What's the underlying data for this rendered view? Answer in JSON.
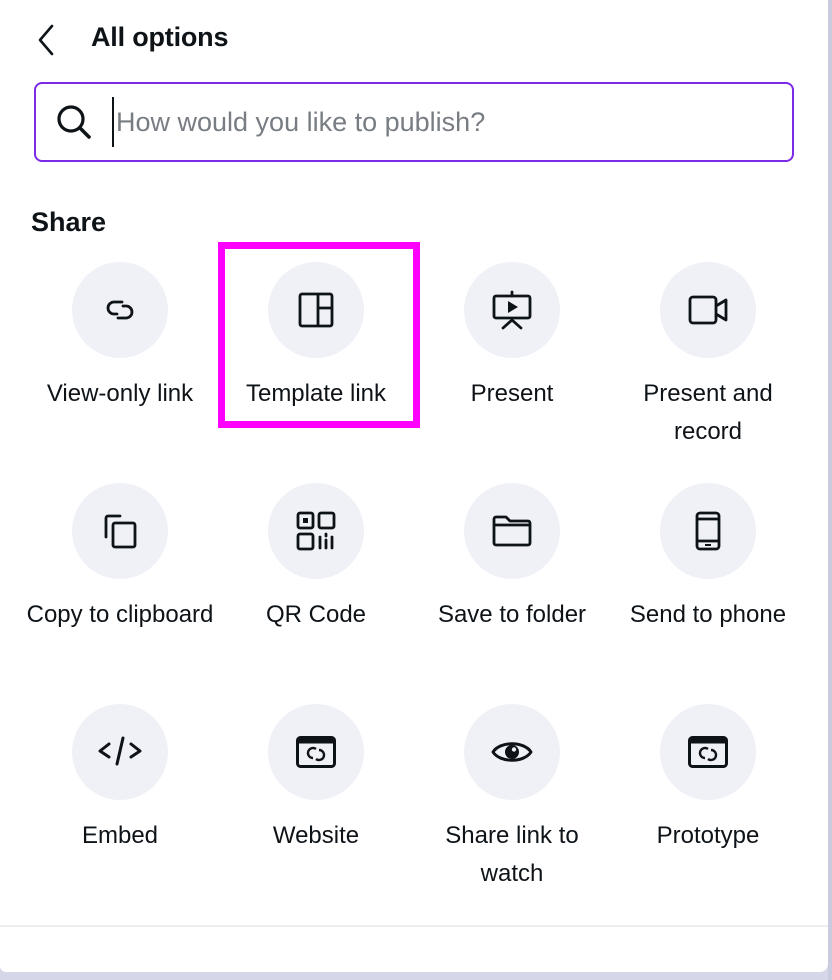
{
  "header": {
    "back_icon": "chevron-left-icon",
    "title": "All options"
  },
  "search": {
    "icon": "search-icon",
    "value": "",
    "placeholder": "How would you like to publish?"
  },
  "colors": {
    "accent": "#7d2ae8",
    "highlight": "#ff00ff",
    "tile_bg": "#eff1f7",
    "text": "#0e1318",
    "placeholder": "#787d83"
  },
  "share": {
    "title": "Share",
    "items": [
      {
        "label": "View-only link",
        "icon": "link-icon"
      },
      {
        "label": "Template link",
        "icon": "template-layout-icon",
        "highlighted": true
      },
      {
        "label": "Present",
        "icon": "presentation-icon"
      },
      {
        "label": "Present and record",
        "icon": "video-camera-icon"
      },
      {
        "label": "Copy to clipboard",
        "icon": "copy-icon"
      },
      {
        "label": "QR Code",
        "icon": "qr-code-icon"
      },
      {
        "label": "Save to folder",
        "icon": "folder-icon"
      },
      {
        "label": "Send to phone",
        "icon": "phone-icon"
      },
      {
        "label": "Embed",
        "icon": "code-icon"
      },
      {
        "label": "Website",
        "icon": "website-link-icon"
      },
      {
        "label": "Share link to watch",
        "icon": "eye-icon"
      },
      {
        "label": "Prototype",
        "icon": "prototype-link-icon"
      }
    ]
  }
}
